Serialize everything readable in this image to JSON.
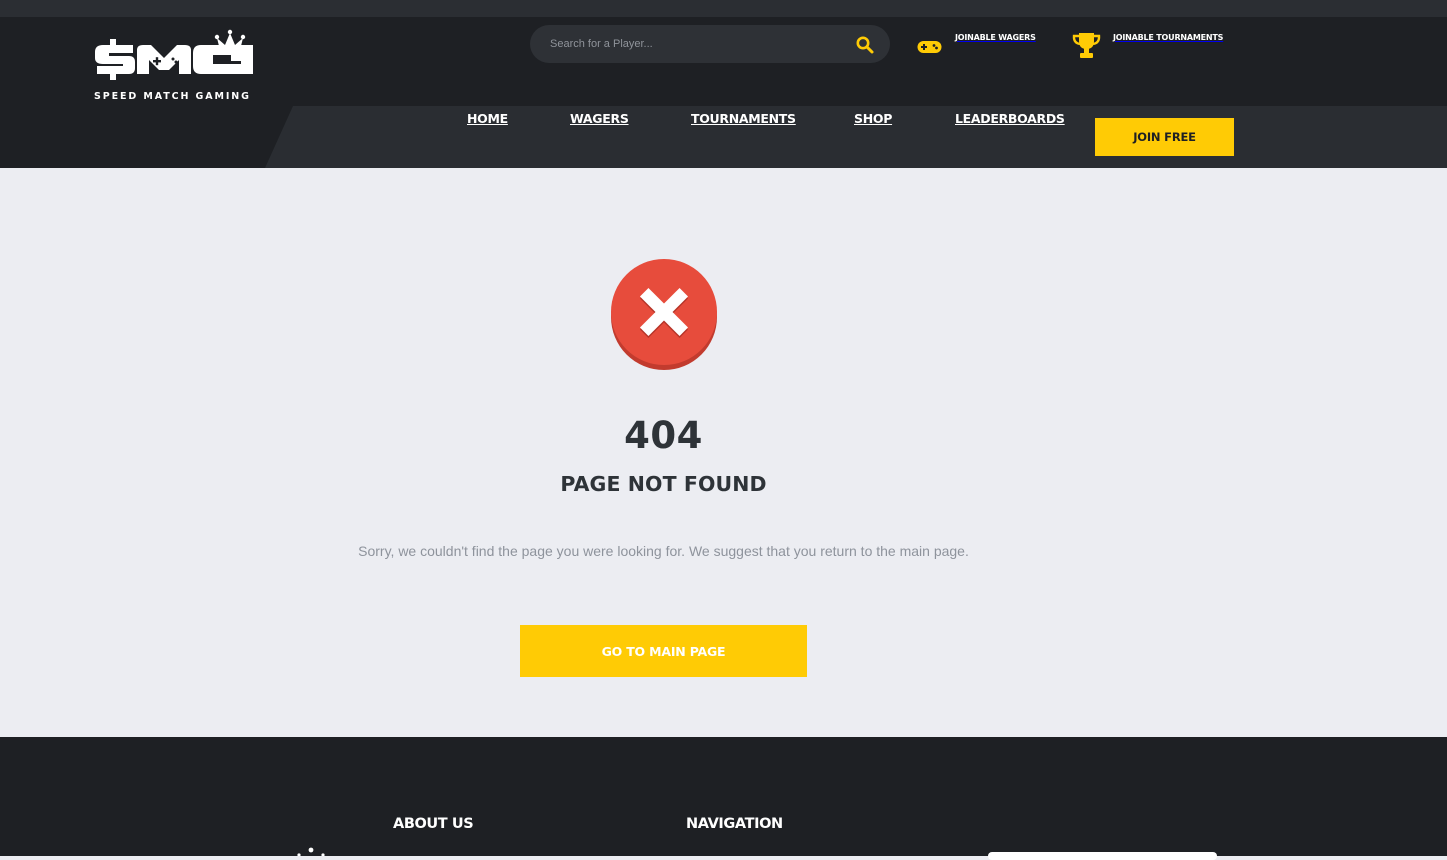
{
  "brand": {
    "logo_text": "SMG",
    "tagline": "SPEED MATCH GAMING"
  },
  "search": {
    "placeholder": "Search for a Player...",
    "icon": "search-icon"
  },
  "quick_links": [
    {
      "label": "JOINABLE WAGERS",
      "icon": "gamepad-icon"
    },
    {
      "label": "JOINABLE TOURNAMENTS",
      "icon": "trophy-icon"
    }
  ],
  "nav": {
    "items": [
      {
        "label": "HOME"
      },
      {
        "label": "WAGERS"
      },
      {
        "label": "TOURNAMENTS"
      },
      {
        "label": "SHOP"
      },
      {
        "label": "LEADERBOARDS"
      }
    ],
    "join_label": "JOIN FREE"
  },
  "error": {
    "icon": "error-x-icon",
    "code": "404",
    "title": "PAGE NOT FOUND",
    "message": "Sorry, we couldn't find the page you were looking for. We suggest that you return to the main page.",
    "button_label": "GO TO MAIN PAGE"
  },
  "footer": {
    "about_heading": "ABOUT US",
    "navigation_heading": "NAVIGATION"
  },
  "colors": {
    "accent": "#ffcb05",
    "header_bg": "#1e2024",
    "nav_bg": "#2a2d32",
    "page_bg": "#ecedf2",
    "error_red": "#e74c3c",
    "heading_text": "#2e3338",
    "muted_text": "#8e939c"
  }
}
